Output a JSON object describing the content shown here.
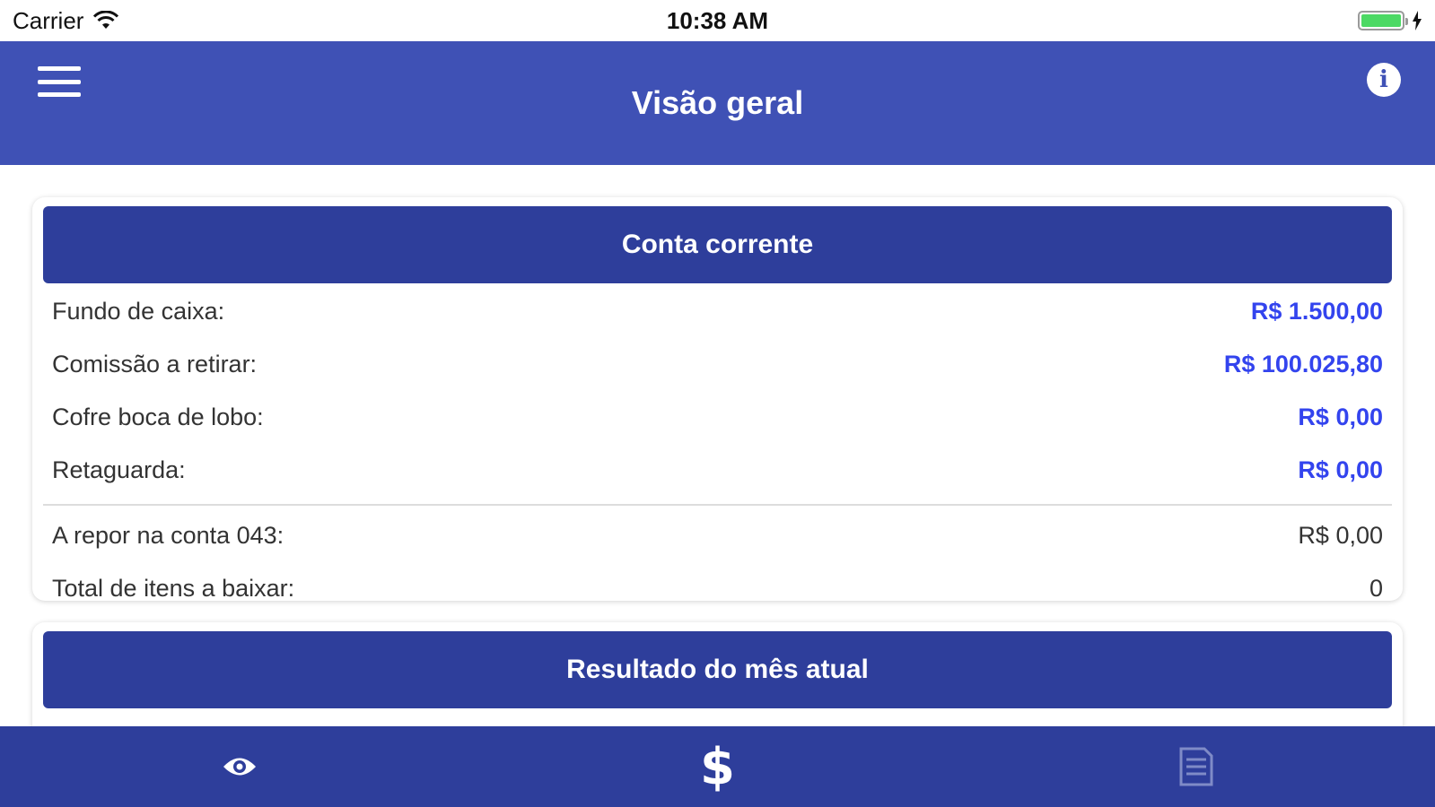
{
  "status_bar": {
    "carrier": "Carrier",
    "time": "10:38 AM",
    "battery_level": 1.0
  },
  "nav": {
    "title": "Visão geral",
    "left_icon": "menu-icon",
    "right_icon": "info-icon"
  },
  "conta_corrente": {
    "title": "Conta corrente",
    "rows": [
      {
        "label": "Fundo de caixa:",
        "value": "R$ 1.500,00"
      },
      {
        "label": "Comissão a retirar:",
        "value": "R$ 100.025,80"
      },
      {
        "label": "Cofre boca de lobo:",
        "value": "R$ 0,00"
      },
      {
        "label": "Retaguarda:",
        "value": "R$ 0,00"
      }
    ],
    "summary_rows": [
      {
        "label": "A repor na conta 043:",
        "value": "R$ 0,00"
      },
      {
        "label": "Total de itens a baixar:",
        "value": "0"
      }
    ]
  },
  "resultado": {
    "title": "Resultado do mês atual"
  },
  "tab_bar": {
    "tabs": [
      {
        "icon": "eye-icon",
        "selected": true
      },
      {
        "icon": "dollar-icon",
        "selected": false
      },
      {
        "icon": "document-icon",
        "selected": false
      }
    ]
  },
  "colors": {
    "nav_bg": "#3f51b5",
    "card_header_bg": "#2e3e9b",
    "value_accent": "#3344ee",
    "tab_bar_bg": "#2e3e9b"
  }
}
